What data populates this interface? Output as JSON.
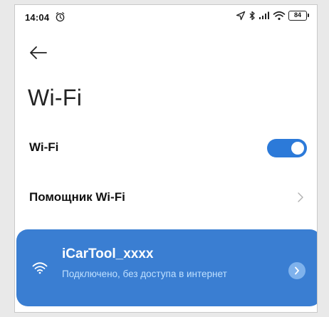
{
  "status_bar": {
    "time": "14:04",
    "battery": "84",
    "icons": [
      "alarm-icon",
      "location-icon",
      "bluetooth-icon",
      "cellular-signal-icon",
      "wifi-icon",
      "battery-icon"
    ]
  },
  "header": {
    "back_icon": "arrow-left-icon",
    "title": "Wi-Fi"
  },
  "settings": {
    "wifi_label": "Wi-Fi",
    "wifi_enabled": true,
    "assistant_label": "Помощник Wi-Fi"
  },
  "network": {
    "name": "iCarTool_xxxx",
    "status": "Подключено, без доступа в интернет",
    "icon": "wifi-icon",
    "details_icon": "chevron-right-icon"
  },
  "colors": {
    "accent": "#2c7ad9",
    "card": "#3a7ed2",
    "card_subtext": "#bfe0ff"
  }
}
